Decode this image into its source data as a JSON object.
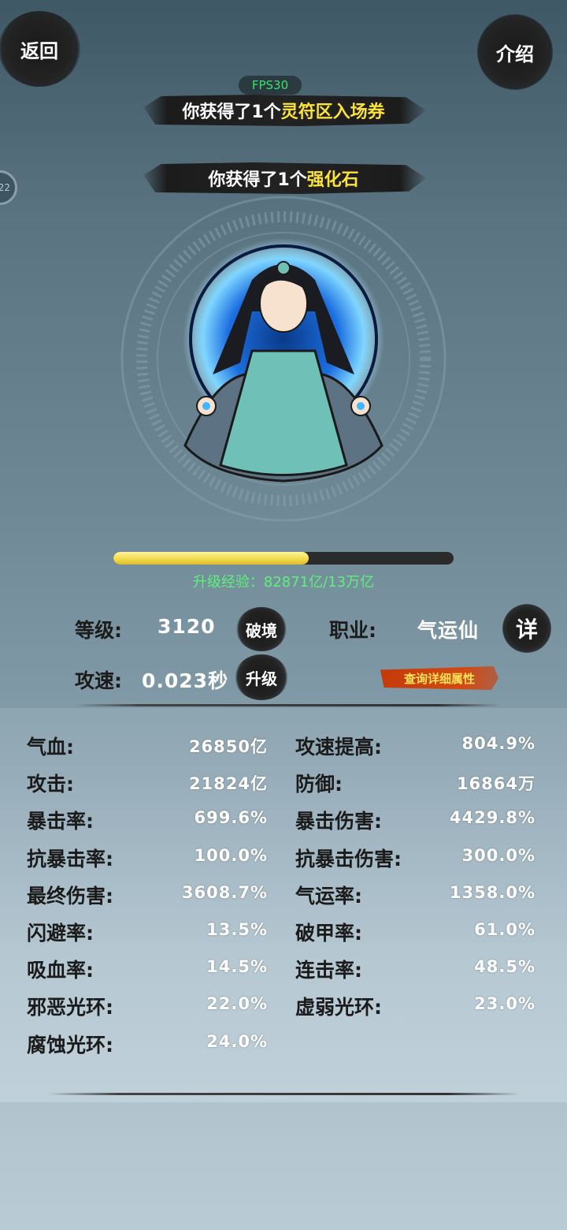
{
  "nav": {
    "back_label": "返回",
    "intro_label": "介绍"
  },
  "fps": "FPS30",
  "toasts": [
    {
      "prefix": "你获得了1个",
      "item": "灵符区入场券"
    },
    {
      "prefix": "你获得了1个",
      "item": "强化石"
    }
  ],
  "side_badge": "22",
  "exp": {
    "label": "升级经验：82871亿/13万亿",
    "progress": 0.575
  },
  "profile": {
    "level_label": "等级:",
    "level_value": "3120",
    "breakthrough_btn": "破境",
    "class_label": "职业:",
    "class_value": "气运仙",
    "detail_icon_btn": "详",
    "speed_label": "攻速:",
    "speed_value": "0.023秒",
    "upgrade_btn": "升级",
    "detail_attr_btn": "查询详细属性"
  },
  "stats": [
    {
      "label": "气血:",
      "value": "26850亿"
    },
    {
      "label": "攻速提高:",
      "value": "804.9%"
    },
    {
      "label": "攻击:",
      "value": "21824亿"
    },
    {
      "label": "防御:",
      "value": "16864万"
    },
    {
      "label": "暴击率:",
      "value": "699.6%"
    },
    {
      "label": "暴击伤害:",
      "value": "4429.8%"
    },
    {
      "label": "抗暴击率:",
      "value": "100.0%"
    },
    {
      "label": "抗暴击伤害:",
      "value": "300.0%"
    },
    {
      "label": "最终伤害:",
      "value": "3608.7%"
    },
    {
      "label": "气运率:",
      "value": "1358.0%"
    },
    {
      "label": "闪避率:",
      "value": "13.5%"
    },
    {
      "label": "破甲率:",
      "value": "61.0%"
    },
    {
      "label": "吸血率:",
      "value": "14.5%"
    },
    {
      "label": "连击率:",
      "value": "48.5%"
    },
    {
      "label": "邪恶光环:",
      "value": "22.0%"
    },
    {
      "label": "虚弱光环:",
      "value": "23.0%"
    },
    {
      "label": "腐蚀光环:",
      "value": "24.0%"
    }
  ],
  "colors": {
    "highlight": "#fbe23b",
    "exp_text": "#5ef07a",
    "fps": "#37e36a",
    "detail_btn": "#c43a0a"
  }
}
